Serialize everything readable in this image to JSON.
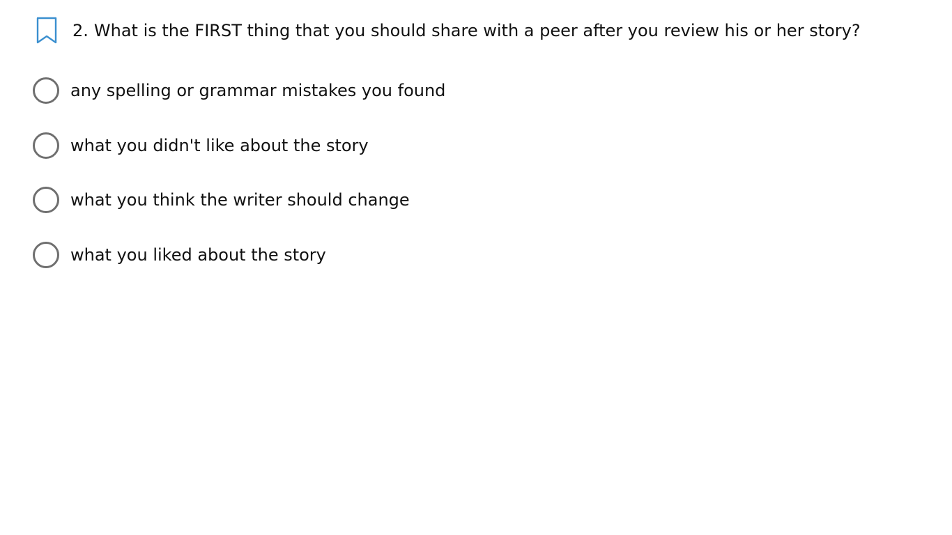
{
  "question": {
    "bookmark_icon": "bookmark-icon",
    "number": "2.",
    "text": "What is the FIRST thing that you should share with a peer after you review his or her story?",
    "accent_color": "#3a8fcf"
  },
  "options": [
    {
      "label": "any spelling or grammar mistakes you found",
      "selected": false
    },
    {
      "label": "what you didn't like about the story",
      "selected": false
    },
    {
      "label": "what you think the writer should change",
      "selected": false
    },
    {
      "label": "what you liked about the story",
      "selected": false
    }
  ],
  "colors": {
    "radio_border": "#6f6f6f",
    "text": "#111111",
    "background": "#ffffff"
  }
}
